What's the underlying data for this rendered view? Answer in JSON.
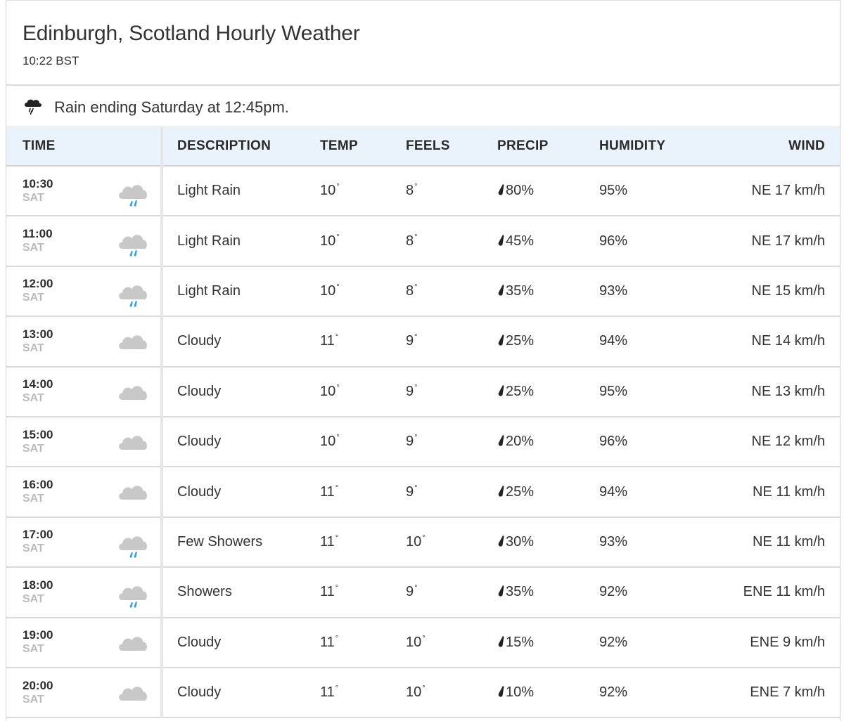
{
  "header": {
    "title": "Edinburgh, Scotland Hourly Weather",
    "time": "10:22 BST"
  },
  "alert": {
    "icon": "rain-cloud-icon",
    "text": "Rain ending Saturday at 12:45pm."
  },
  "columns": {
    "time": "TIME",
    "description": "DESCRIPTION",
    "temp": "TEMP",
    "feels": "FEELS",
    "precip": "PRECIP",
    "humidity": "HUMIDITY",
    "wind": "WIND"
  },
  "degree_symbol": "°",
  "colors": {
    "cloud": "#c8c8c8",
    "rain_drop": "#3f9fd0",
    "header_bg": "#eaf3fb"
  },
  "rows": [
    {
      "time": "10:30",
      "day": "SAT",
      "icon": "rain",
      "description": "Light Rain",
      "temp": "10",
      "feels": "8",
      "precip": "80%",
      "humidity": "95%",
      "wind": "NE 17 km/h"
    },
    {
      "time": "11:00",
      "day": "SAT",
      "icon": "rain",
      "description": "Light Rain",
      "temp": "10",
      "feels": "8",
      "precip": "45%",
      "humidity": "96%",
      "wind": "NE 17 km/h"
    },
    {
      "time": "12:00",
      "day": "SAT",
      "icon": "rain",
      "description": "Light Rain",
      "temp": "10",
      "feels": "8",
      "precip": "35%",
      "humidity": "93%",
      "wind": "NE 15 km/h"
    },
    {
      "time": "13:00",
      "day": "SAT",
      "icon": "cloud",
      "description": "Cloudy",
      "temp": "11",
      "feels": "9",
      "precip": "25%",
      "humidity": "94%",
      "wind": "NE 14 km/h"
    },
    {
      "time": "14:00",
      "day": "SAT",
      "icon": "cloud",
      "description": "Cloudy",
      "temp": "10",
      "feels": "9",
      "precip": "25%",
      "humidity": "95%",
      "wind": "NE 13 km/h"
    },
    {
      "time": "15:00",
      "day": "SAT",
      "icon": "cloud",
      "description": "Cloudy",
      "temp": "10",
      "feels": "9",
      "precip": "20%",
      "humidity": "96%",
      "wind": "NE 12 km/h"
    },
    {
      "time": "16:00",
      "day": "SAT",
      "icon": "cloud",
      "description": "Cloudy",
      "temp": "11",
      "feels": "9",
      "precip": "25%",
      "humidity": "94%",
      "wind": "NE 11 km/h"
    },
    {
      "time": "17:00",
      "day": "SAT",
      "icon": "rain",
      "description": "Few Showers",
      "temp": "11",
      "feels": "10",
      "precip": "30%",
      "humidity": "93%",
      "wind": "NE 11 km/h"
    },
    {
      "time": "18:00",
      "day": "SAT",
      "icon": "rain",
      "description": "Showers",
      "temp": "11",
      "feels": "9",
      "precip": "35%",
      "humidity": "92%",
      "wind": "ENE 11 km/h"
    },
    {
      "time": "19:00",
      "day": "SAT",
      "icon": "cloud",
      "description": "Cloudy",
      "temp": "11",
      "feels": "10",
      "precip": "15%",
      "humidity": "92%",
      "wind": "ENE 9 km/h"
    },
    {
      "time": "20:00",
      "day": "SAT",
      "icon": "cloud",
      "description": "Cloudy",
      "temp": "11",
      "feels": "10",
      "precip": "10%",
      "humidity": "92%",
      "wind": "ENE 7 km/h"
    }
  ]
}
